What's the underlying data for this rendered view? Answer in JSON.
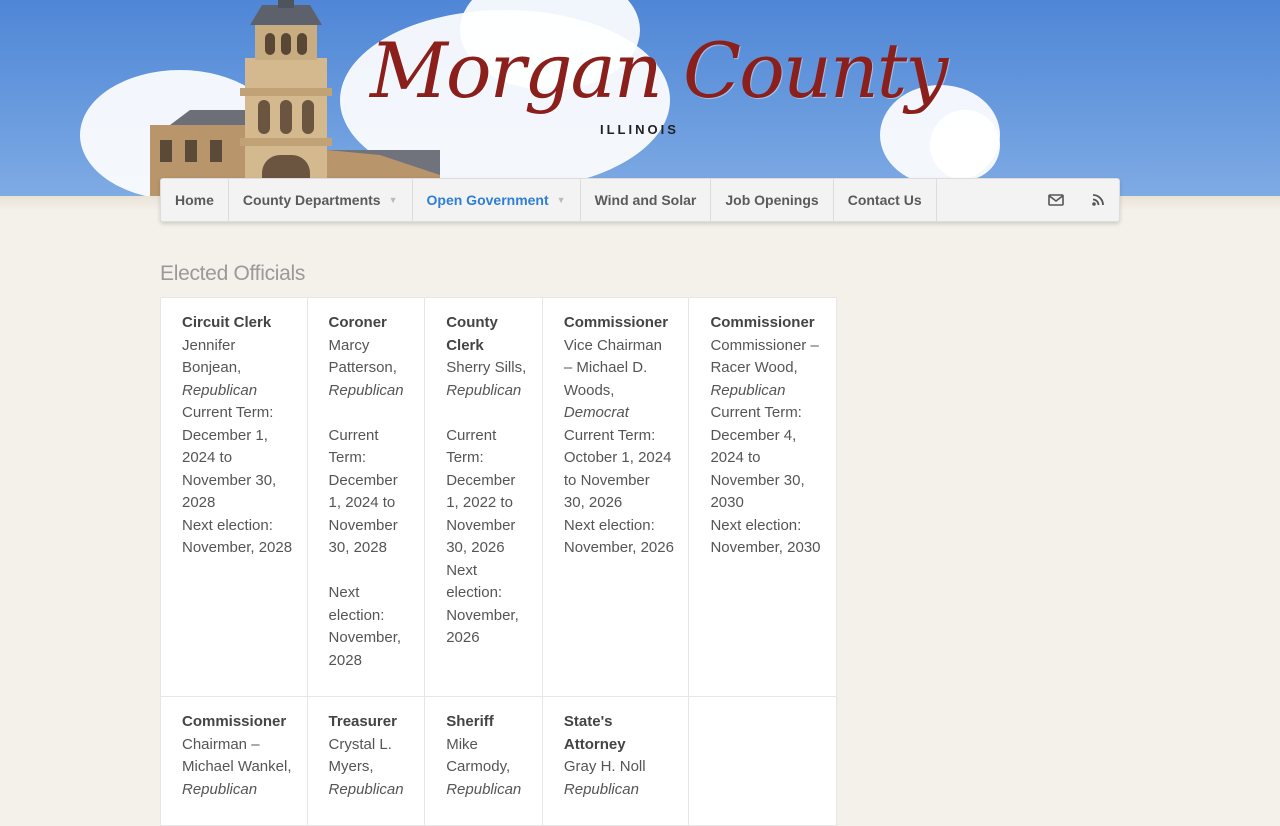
{
  "header": {
    "logo_script": "Morgan County",
    "logo_sub": "ILLINOIS"
  },
  "nav": {
    "items": [
      {
        "label": "Home"
      },
      {
        "label": "County Departments"
      },
      {
        "label": "Open Government"
      },
      {
        "label": "Wind and Solar"
      },
      {
        "label": "Job Openings"
      },
      {
        "label": "Contact Us"
      }
    ],
    "active": "Open Government"
  },
  "page": {
    "title": "Elected Officials"
  },
  "officials": {
    "row1": [
      {
        "title": "Circuit Clerk",
        "name": "Jennifer Bonjean,",
        "party": "Republican",
        "term": "Current Term: December 1, 2024 to November 30, 2028",
        "election": "Next election: November, 2028"
      },
      {
        "title": "Coroner",
        "name": "Marcy Patterson,",
        "party": "Republican",
        "term": "Current Term: December 1, 2024 to November 30, 2028",
        "election": "Next election: November, 2028"
      },
      {
        "title": "County Clerk",
        "name": "Sherry Sills,",
        "party": "Republican",
        "term": "Current Term: December 1, 2022 to November 30, 2026",
        "election": "Next election: November, 2026"
      },
      {
        "title": "Commissioner",
        "name": "Vice Chairman – Michael D. Woods,",
        "party": "Democrat",
        "term": "Current Term: October 1, 2024 to November 30, 2026",
        "election": "Next election: November, 2026"
      },
      {
        "title": "Commissioner",
        "name": "Commissioner – Racer Wood,",
        "party": "Republican",
        "term": "Current Term: December 4, 2024 to November 30, 2030",
        "election": "Next election: November, 2030"
      }
    ],
    "row2": [
      {
        "title": "Commissioner",
        "name": "Chairman – Michael Wankel,",
        "party": "Republican"
      },
      {
        "title": "Treasurer",
        "name": "Crystal L. Myers,",
        "party": "Republican"
      },
      {
        "title": "Sheriff",
        "name": "Mike Carmody,",
        "party": "Republican"
      },
      {
        "title": "State's Attorney",
        "name": "Gray H. Noll",
        "party": "Republican"
      }
    ]
  },
  "icons": {
    "email": "envelope-icon",
    "rss": "rss-icon"
  },
  "colors": {
    "sky": "#5a8fd9",
    "logo_red": "#8a1f1c",
    "nav_active": "#2f7fd6",
    "nav_bg": "#f3f3f3",
    "page_bg": "#f4f0ea"
  }
}
